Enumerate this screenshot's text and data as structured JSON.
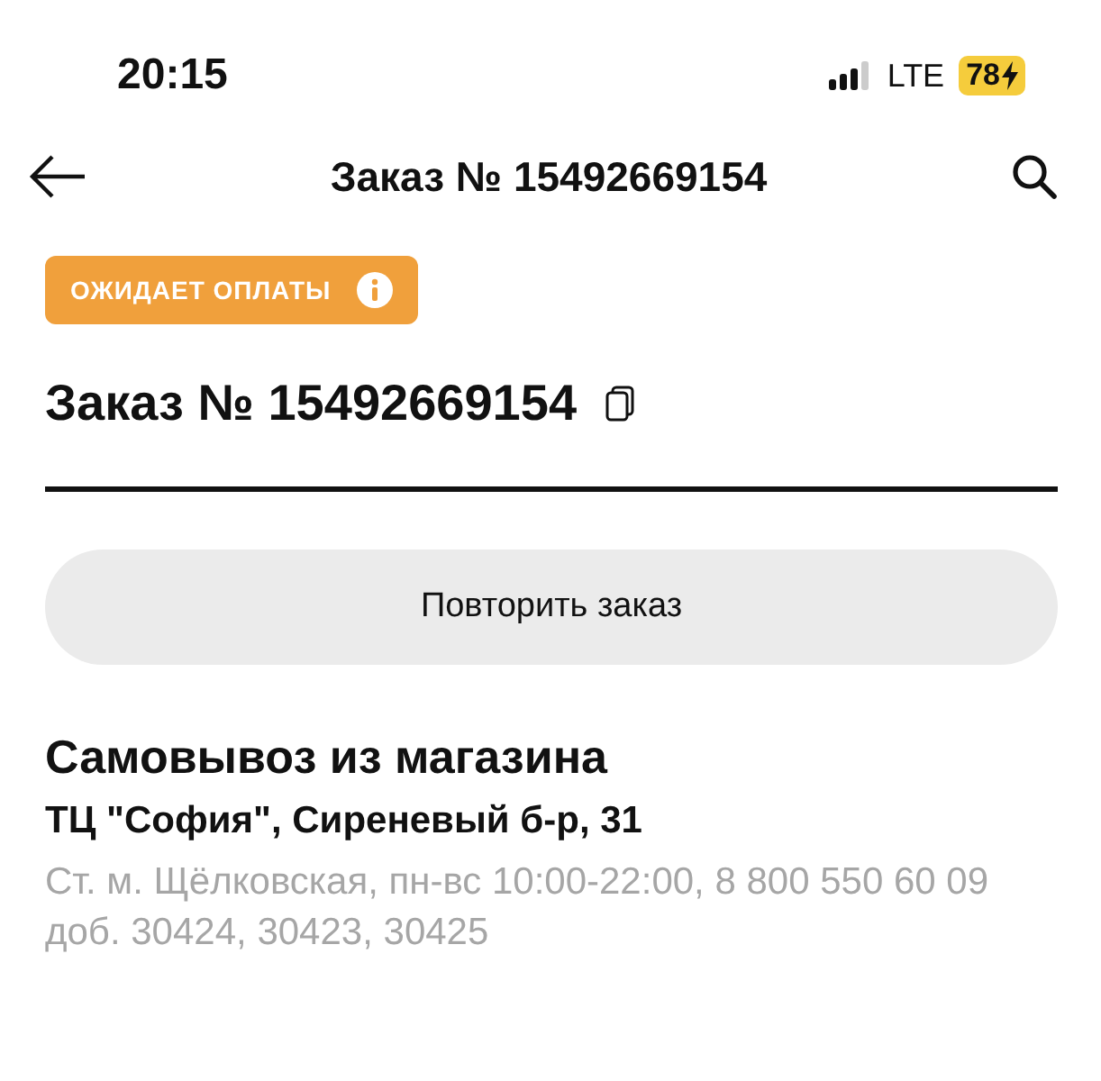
{
  "status_bar": {
    "time": "20:15",
    "network": "LTE",
    "battery": "78"
  },
  "nav": {
    "title": "Заказ № 15492669154"
  },
  "status_badge": {
    "label": "ОЖИДАЕТ ОПЛАТЫ"
  },
  "order": {
    "title": "Заказ № 15492669154"
  },
  "repeat_button": {
    "label": "Повторить заказ"
  },
  "delivery": {
    "method": "Самовывоз из магазина",
    "address": "ТЦ \"София\", Сиреневый б-р, 31",
    "details": "Ст. м. Щёлковская, пн-вс 10:00-22:00, 8 800 550 60 09 доб. 30424, 30423, 30425"
  }
}
